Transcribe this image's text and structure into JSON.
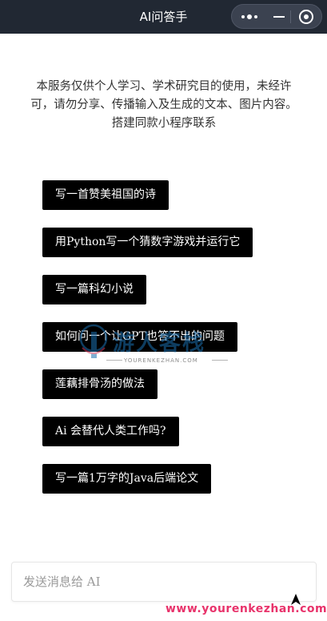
{
  "nav": {
    "title": "AI问答手"
  },
  "notice": "本服务仅供个人学习、学术研究目的使用，未经许可，请勿分享、传播输入及生成的文本、图片内容。搭建同款小程序联系",
  "suggestions": [
    "写一首赞美祖国的诗",
    "用Python写一个猜数字游戏并运行它",
    "写一篇科幻小说",
    "如何问一个让GPT也答不出的问题",
    "莲藕排骨汤的做法",
    "Ai 会替代人类工作吗?",
    "写一篇1万字的Java后端论文"
  ],
  "watermark": {
    "brand": "游人客栈",
    "url": "YOURENKEZHAN.COM"
  },
  "input": {
    "placeholder": "发送消息给 AI"
  },
  "footer_url": "www.yourenkezhan.com"
}
